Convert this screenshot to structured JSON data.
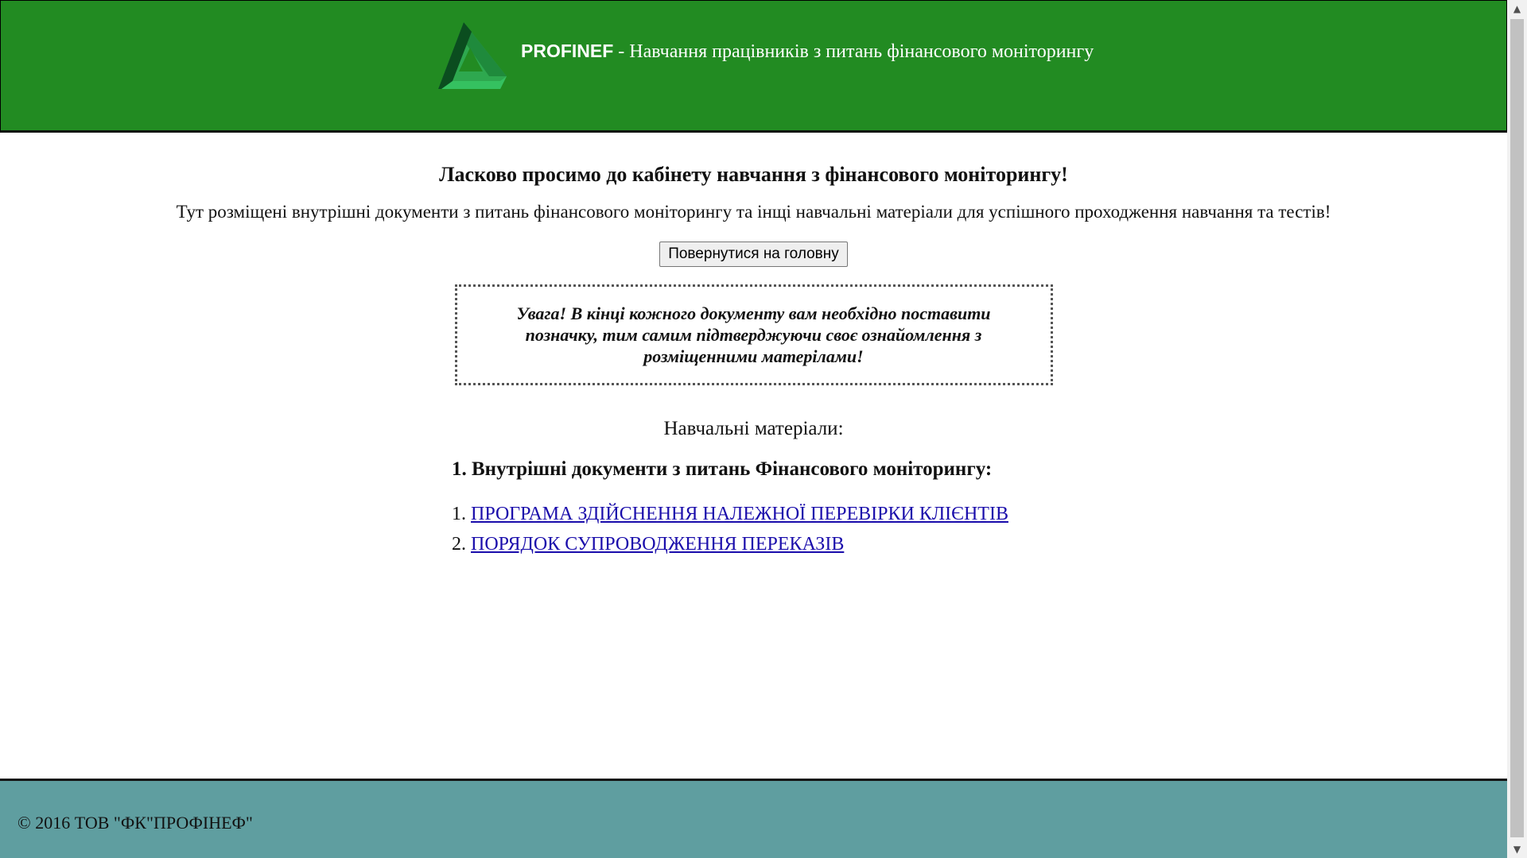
{
  "header": {
    "brand": "PROFINEF",
    "subtitle": " - Навчання працівників з питань фінансового моніторингу",
    "logo_icon": "triangle-logo-icon"
  },
  "main": {
    "welcome": "Ласково просимо до кабінету навчання з фінансового моніторингу!",
    "intro": "Тут розміщені внутрішні документи з питань фінансового моніторингу та інщі навчальні матеріали для успішного проходження навчання та тестів!",
    "back_button_label": "Повернутися на головну",
    "notice": "Увага! В кінці кожного документу вам необхідно поставити позначку, тим самим підтверджуючи своє ознайомлення з розміщенними матерілами!",
    "materials_title": "Навчальні матеріали:",
    "section_title": "1. Внутрішні документи з питань Фінансового моніторингу:",
    "documents": [
      {
        "number": "1.",
        "label": "ПРОГРАМА ЗДІЙСНЕННЯ НАЛЕЖНОЇ ПЕРЕВІРКИ КЛІЄНТІВ"
      },
      {
        "number": "2.",
        "label": "ПОРЯДОК СУПРОВОДЖЕННЯ ПЕРЕКАЗІВ"
      }
    ]
  },
  "footer": {
    "copyright": "© 2016 ТОВ \"ФК\"ПРОФІНЕФ\""
  },
  "colors": {
    "header_bg": "#228b22",
    "footer_bg": "#5f9ea0",
    "link": "#1a0dab"
  }
}
